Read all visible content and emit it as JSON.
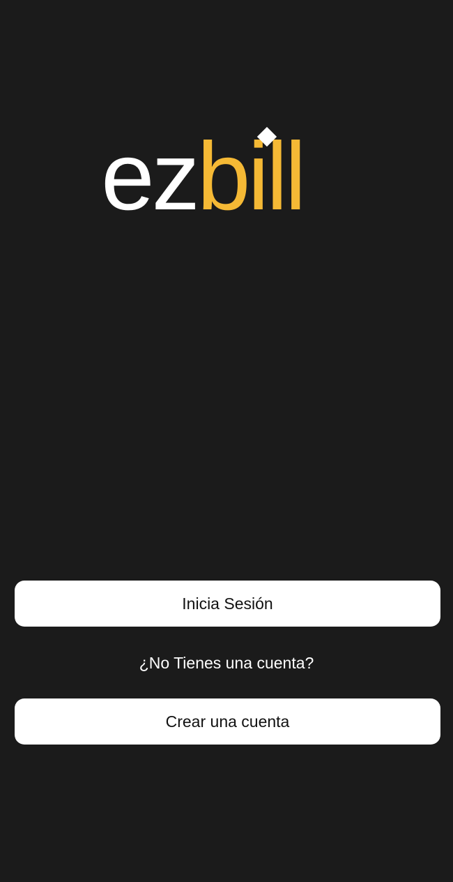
{
  "brand": {
    "name_part1": "ez",
    "name_part2": "bill",
    "color_primary": "#ffffff",
    "color_accent": "#f5b935"
  },
  "auth": {
    "login_label": "Inicia Sesión",
    "prompt_text": "¿No Tienes una cuenta?",
    "create_label": "Crear una cuenta"
  },
  "colors": {
    "background": "#1b1b1b",
    "button_bg": "#ffffff",
    "button_text": "#111111"
  }
}
